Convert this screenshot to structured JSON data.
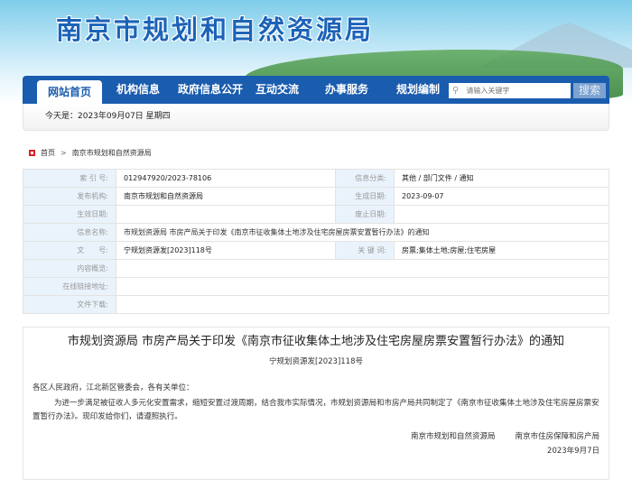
{
  "site_title": "南京市规划和自然资源局",
  "nav": {
    "items": [
      "网站首页",
      "机构信息",
      "政府信息公开",
      "互动交流",
      "办事服务",
      "规划编制"
    ],
    "search_placeholder": "请输入关键字",
    "search_button": "搜索"
  },
  "date_text": "今天是：2023年09月07日  星期四",
  "breadcrumb": {
    "home": "首页",
    "sep": ">",
    "current": "南京市规划和自然资源局"
  },
  "meta": {
    "index_label": "索 引 号:",
    "index": "012947920/2023-78106",
    "category_label": "信息分类:",
    "category": "其他 / 部门文件 / 通知",
    "publisher_label": "发布机构:",
    "publisher": "南京市规划和自然资源局",
    "created_label": "生成日期:",
    "created": "2023-09-07",
    "effective_label": "生效日期:",
    "effective": "",
    "expire_label": "废止日期:",
    "expire": "",
    "name_label": "信息名称:",
    "name": "市规划资源局 市房产局关于印发《南京市征收集体土地涉及住宅房屋房票安置暂行办法》的通知",
    "docno_label": "文　　号:",
    "docno": "宁规划资源发[2023]118号",
    "keywords_label": "关 键 词:",
    "keywords": "房票;集体土地;房屋;住宅房屋",
    "summary_label": "内容概览:",
    "link_label": "在线链接地址:",
    "download_label": "文件下载:"
  },
  "article": {
    "title": "市规划资源局 市房产局关于印发《南京市征收集体土地涉及住宅房屋房票安置暂行办法》的通知",
    "docno": "宁规划资源发[2023]118号",
    "addressee": "各区人民政府，江北新区管委会，各有关单位：",
    "body": "为进一步满足被征收人多元化安置需求，缩短安置过渡周期，结合我市实际情况，市规划资源局和市房产局共同制定了《南京市征收集体土地涉及住宅房屋房票安置暂行办法》。现印发给你们，请遵照执行。",
    "signer1": "南京市规划和自然资源局",
    "signer2": "南京市住房保障和房产局",
    "date": "2023年9月7日"
  }
}
